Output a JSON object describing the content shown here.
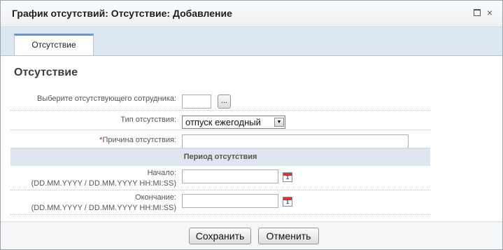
{
  "window": {
    "title": "График отсутствий: Отсутствие: Добавление",
    "maximize_icon": "maximize-icon",
    "close_icon": "close-icon",
    "close_glyph": "×"
  },
  "tabs": [
    {
      "label": "Отсутствие",
      "active": true
    }
  ],
  "section": {
    "title": "Отсутствие"
  },
  "form": {
    "employee": {
      "label": "Выберите отсутствующего сотрудника:",
      "value": "",
      "picker_label": "..."
    },
    "absence_type": {
      "label": "Тип отсутствия:",
      "selected": "отпуск ежегодный"
    },
    "reason": {
      "required_mark": "*",
      "label": "Причина отсутствия:",
      "value": ""
    },
    "period": {
      "header": "Период отсутствия"
    },
    "start": {
      "label": "Начало:",
      "format": "(DD.MM.YYYY / DD.MM.YYYY HH:MI:SS)",
      "value": "",
      "calendar_icon": "calendar-icon",
      "calendar_day": "1"
    },
    "end": {
      "label": "Окончание:",
      "format": "(DD.MM.YYYY / DD.MM.YYYY HH:MI:SS)",
      "value": "",
      "calendar_icon": "calendar-icon",
      "calendar_day": "1"
    }
  },
  "footer": {
    "save_label": "Сохранить",
    "cancel_label": "Отменить"
  },
  "colors": {
    "tab_accent": "#7394bb",
    "required": "#ee1111",
    "header_band": "#dfe6f0"
  }
}
